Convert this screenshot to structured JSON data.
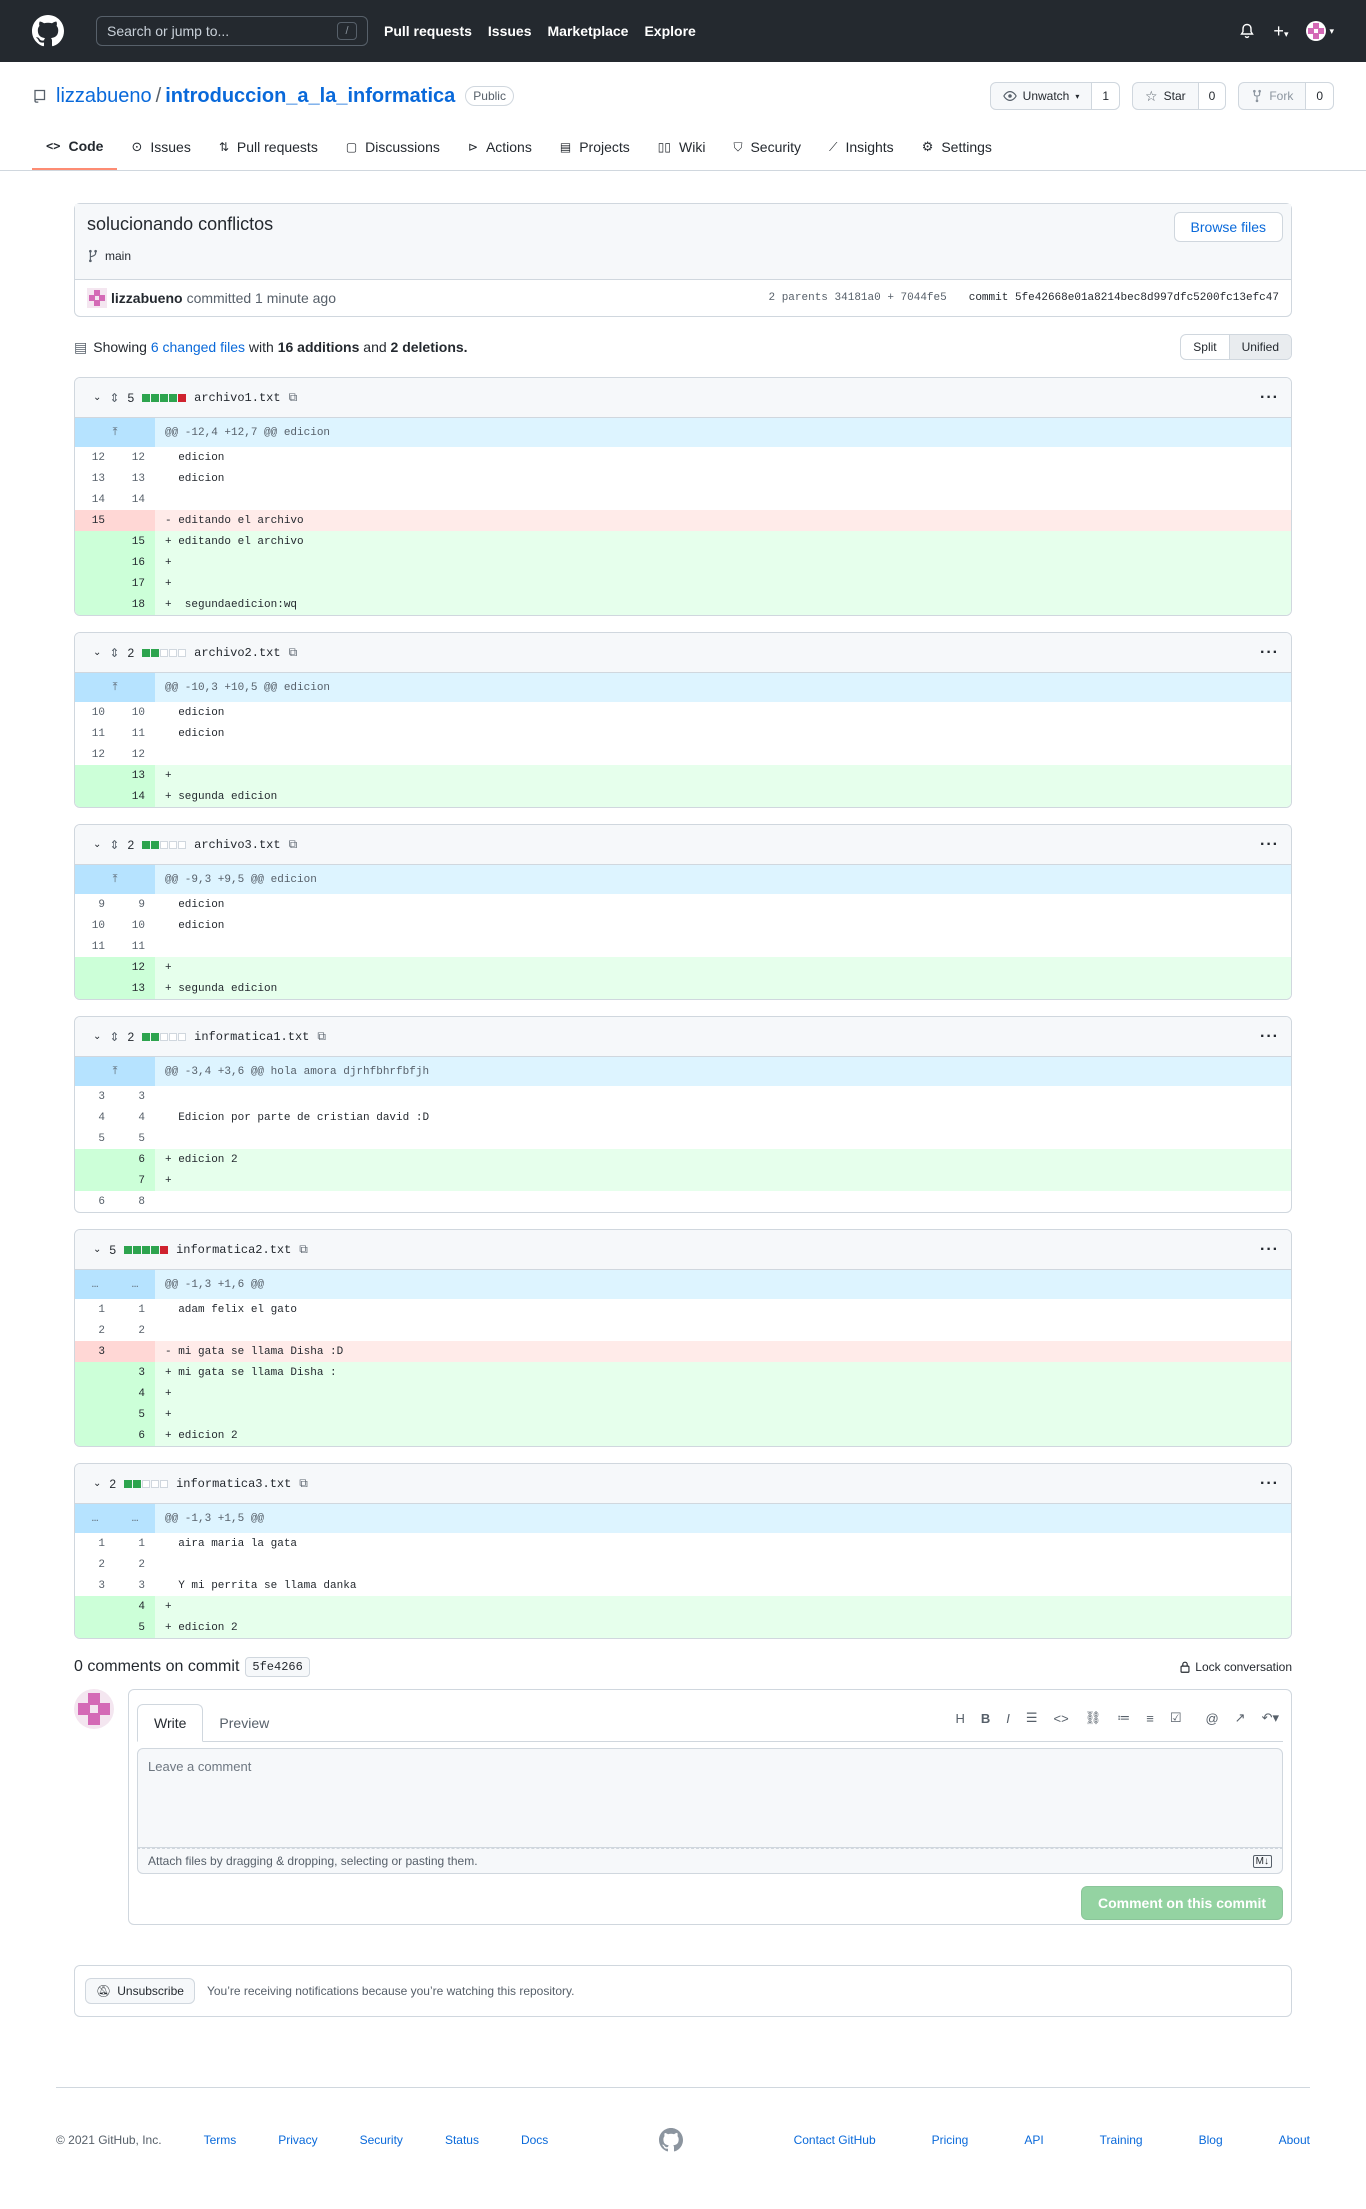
{
  "header": {
    "search_placeholder": "Search or jump to...",
    "slash": "/",
    "nav": [
      "Pull requests",
      "Issues",
      "Marketplace",
      "Explore"
    ]
  },
  "repo": {
    "owner": "lizzabueno",
    "separator": "/",
    "name": "introduccion_a_la_informatica",
    "visibility": "Public",
    "watch_label": "Unwatch",
    "watch_count": "1",
    "star_label": "Star",
    "star_count": "0",
    "fork_label": "Fork",
    "fork_count": "0"
  },
  "tabs": [
    "Code",
    "Issues",
    "Pull requests",
    "Discussions",
    "Actions",
    "Projects",
    "Wiki",
    "Security",
    "Insights",
    "Settings"
  ],
  "commit": {
    "message": "solucionando conflictos",
    "branch": "main",
    "browse_label": "Browse files",
    "author": "lizzabueno",
    "action": "committed",
    "time": "1 minute ago",
    "parents": "2 parents 34181a0 + 7044fe5",
    "sha_full": "commit 5fe42668e01a8214bec8d997dfc5200fc13efc47"
  },
  "summary": {
    "showing": "Showing",
    "changed": "6 changed files",
    "with": "with",
    "additions": "16 additions",
    "and": "and",
    "deletions": "2 deletions.",
    "split": "Split",
    "unified": "Unified"
  },
  "files": [
    {
      "count": "5",
      "blocks": [
        "g",
        "g",
        "g",
        "g",
        "r"
      ],
      "name": "archivo1.txt",
      "expand": true,
      "hunk": "@@ -12,4 +12,7 @@ edicion",
      "lines": [
        {
          "t": "ctx",
          "o": "12",
          "n": "12",
          "c": "  edicion"
        },
        {
          "t": "ctx",
          "o": "13",
          "n": "13",
          "c": "  edicion"
        },
        {
          "t": "ctx",
          "o": "14",
          "n": "14",
          "c": ""
        },
        {
          "t": "del",
          "o": "15",
          "n": "",
          "c": "- editando el archivo"
        },
        {
          "t": "add",
          "o": "",
          "n": "15",
          "c": "+ editando el archivo"
        },
        {
          "t": "add",
          "o": "",
          "n": "16",
          "c": "+"
        },
        {
          "t": "add",
          "o": "",
          "n": "17",
          "c": "+"
        },
        {
          "t": "add",
          "o": "",
          "n": "18",
          "c": "+  segundaedicion:wq"
        }
      ]
    },
    {
      "count": "2",
      "blocks": [
        "g",
        "g",
        "n",
        "n",
        "n"
      ],
      "name": "archivo2.txt",
      "expand": true,
      "hunk": "@@ -10,3 +10,5 @@ edicion",
      "lines": [
        {
          "t": "ctx",
          "o": "10",
          "n": "10",
          "c": "  edicion"
        },
        {
          "t": "ctx",
          "o": "11",
          "n": "11",
          "c": "  edicion"
        },
        {
          "t": "ctx",
          "o": "12",
          "n": "12",
          "c": ""
        },
        {
          "t": "add",
          "o": "",
          "n": "13",
          "c": "+"
        },
        {
          "t": "add",
          "o": "",
          "n": "14",
          "c": "+ segunda edicion"
        }
      ]
    },
    {
      "count": "2",
      "blocks": [
        "g",
        "g",
        "n",
        "n",
        "n"
      ],
      "name": "archivo3.txt",
      "expand": true,
      "hunk": "@@ -9,3 +9,5 @@ edicion",
      "lines": [
        {
          "t": "ctx",
          "o": "9",
          "n": "9",
          "c": "  edicion"
        },
        {
          "t": "ctx",
          "o": "10",
          "n": "10",
          "c": "  edicion"
        },
        {
          "t": "ctx",
          "o": "11",
          "n": "11",
          "c": ""
        },
        {
          "t": "add",
          "o": "",
          "n": "12",
          "c": "+"
        },
        {
          "t": "add",
          "o": "",
          "n": "13",
          "c": "+ segunda edicion"
        }
      ]
    },
    {
      "count": "2",
      "blocks": [
        "g",
        "g",
        "n",
        "n",
        "n"
      ],
      "name": "informatica1.txt",
      "expand": true,
      "hunk": "@@ -3,4 +3,6 @@ hola amora djrhfbhrfbfjh",
      "lines": [
        {
          "t": "ctx",
          "o": "3",
          "n": "3",
          "c": ""
        },
        {
          "t": "ctx",
          "o": "4",
          "n": "4",
          "c": "  Edicion por parte de cristian david :D"
        },
        {
          "t": "ctx",
          "o": "5",
          "n": "5",
          "c": ""
        },
        {
          "t": "add",
          "o": "",
          "n": "6",
          "c": "+ edicion 2"
        },
        {
          "t": "add",
          "o": "",
          "n": "7",
          "c": "+"
        },
        {
          "t": "ctx",
          "o": "6",
          "n": "8",
          "c": ""
        }
      ]
    },
    {
      "count": "5",
      "blocks": [
        "g",
        "g",
        "g",
        "g",
        "r"
      ],
      "name": "informatica2.txt",
      "expand": false,
      "hunk": "@@ -1,3 +1,6 @@",
      "lines": [
        {
          "t": "ctx",
          "o": "1",
          "n": "1",
          "c": "  adam felix el gato"
        },
        {
          "t": "ctx",
          "o": "2",
          "n": "2",
          "c": ""
        },
        {
          "t": "del",
          "o": "3",
          "n": "",
          "c": "- mi gata se llama Disha :D"
        },
        {
          "t": "add",
          "o": "",
          "n": "3",
          "c": "+ mi gata se llama Disha :"
        },
        {
          "t": "add",
          "o": "",
          "n": "4",
          "c": "+"
        },
        {
          "t": "add",
          "o": "",
          "n": "5",
          "c": "+"
        },
        {
          "t": "add",
          "o": "",
          "n": "6",
          "c": "+ edicion 2"
        }
      ]
    },
    {
      "count": "2",
      "blocks": [
        "g",
        "g",
        "n",
        "n",
        "n"
      ],
      "name": "informatica3.txt",
      "expand": false,
      "hunk": "@@ -1,3 +1,5 @@",
      "lines": [
        {
          "t": "ctx",
          "o": "1",
          "n": "1",
          "c": "  aira maria la gata"
        },
        {
          "t": "ctx",
          "o": "2",
          "n": "2",
          "c": ""
        },
        {
          "t": "ctx",
          "o": "3",
          "n": "3",
          "c": "  Y mi perrita se llama danka"
        },
        {
          "t": "add",
          "o": "",
          "n": "4",
          "c": "+"
        },
        {
          "t": "add",
          "o": "",
          "n": "5",
          "c": "+ edicion 2"
        }
      ]
    }
  ],
  "comments": {
    "title": "0 comments on commit",
    "sha": "5fe4266",
    "lock": "Lock conversation",
    "write": "Write",
    "preview": "Preview",
    "placeholder": "Leave a comment",
    "attach": "Attach files by dragging & dropping, selecting or pasting them.",
    "submit": "Comment on this commit"
  },
  "notifications": {
    "unsubscribe": "Unsubscribe",
    "text": "You’re receiving notifications because you’re watching this repository."
  },
  "footer": {
    "copyright": "© 2021 GitHub, Inc.",
    "left_links": [
      "Terms",
      "Privacy",
      "Security",
      "Status",
      "Docs"
    ],
    "right_links": [
      "Contact GitHub",
      "Pricing",
      "API",
      "Training",
      "Blog",
      "About"
    ]
  },
  "colors": {
    "header_bg": "#24292f",
    "link": "#0969da",
    "addition": "#2da44e",
    "deletion": "#cf222e",
    "tab_underline": "#fd8c73"
  }
}
